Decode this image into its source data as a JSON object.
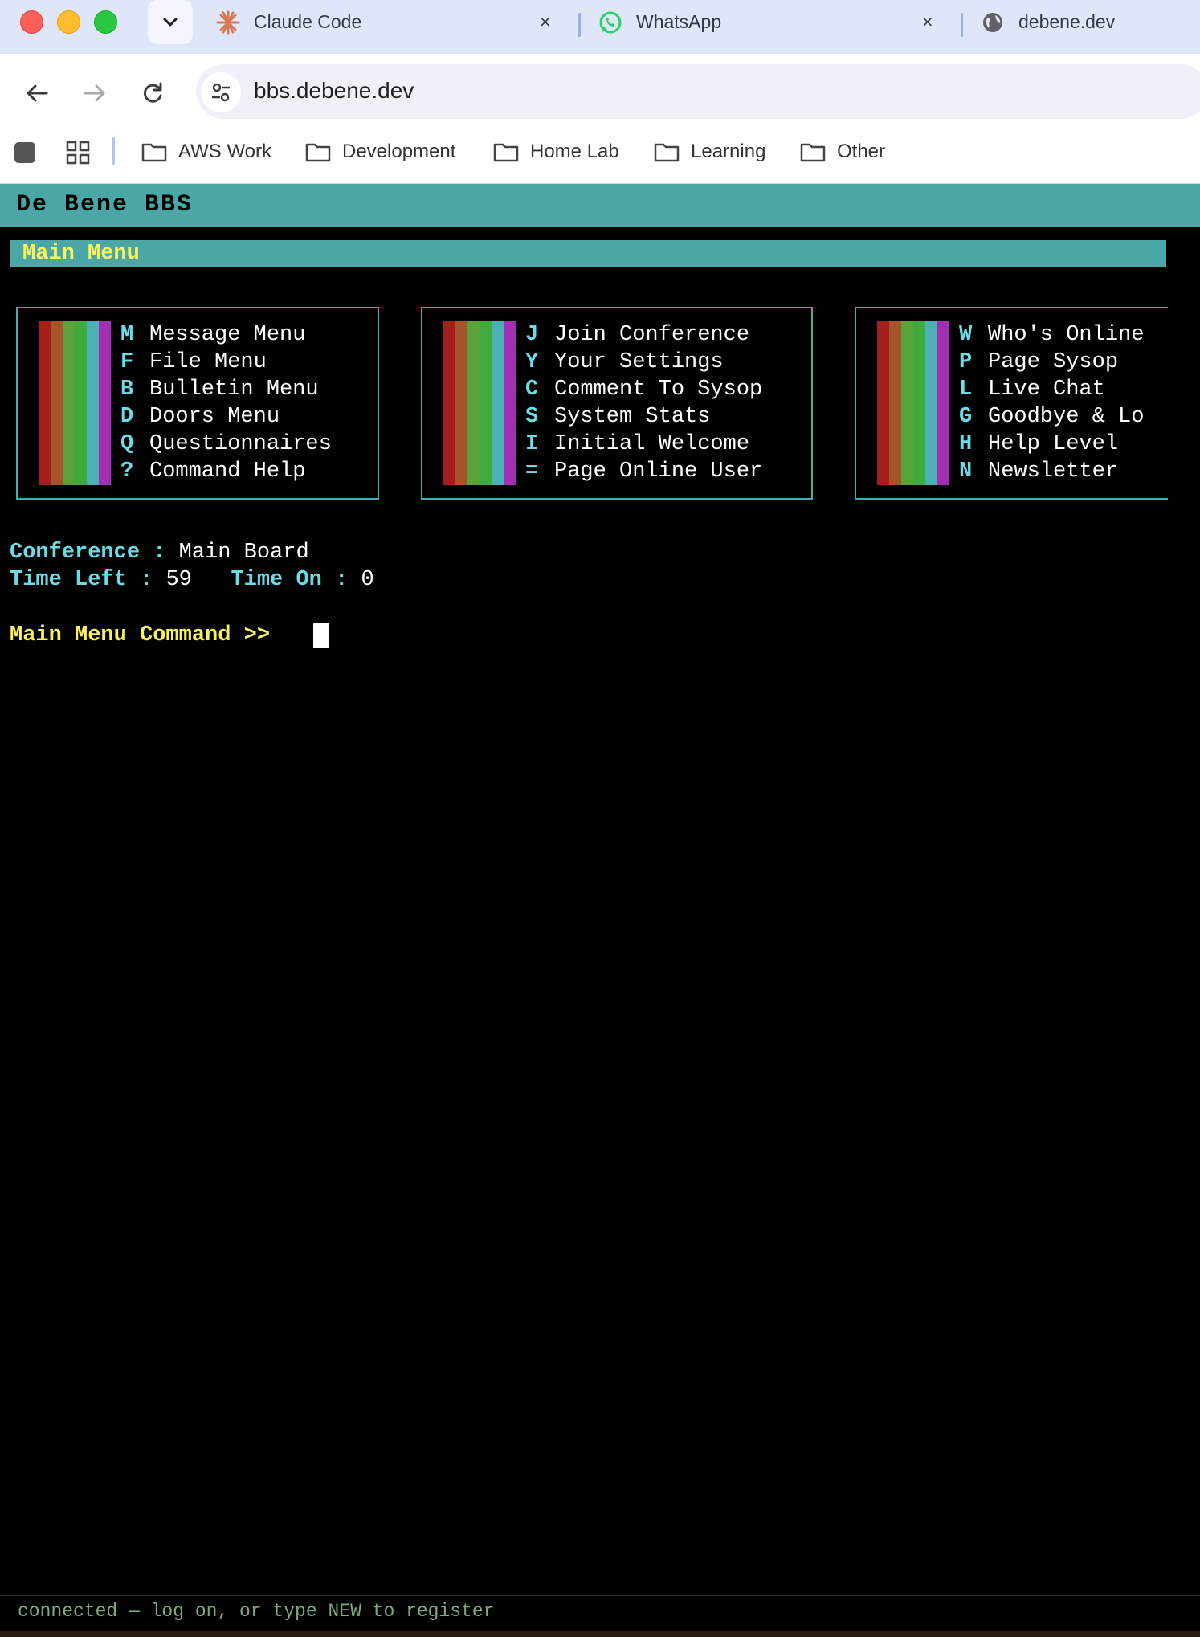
{
  "browser": {
    "tabs": [
      {
        "title": "Claude Code",
        "icon": "claude-icon"
      },
      {
        "title": "WhatsApp",
        "icon": "whatsapp-icon"
      },
      {
        "title": "debene.dev",
        "icon": "globe-icon"
      }
    ],
    "close_glyph": "×",
    "url": "bbs.debene.dev",
    "bookmarks": [
      "AWS Work",
      "Development",
      "Home Lab",
      "Learning",
      "Other"
    ]
  },
  "bbs": {
    "title": "De Bene BBS",
    "menu_header": "Main Menu",
    "columns": [
      [
        {
          "key": "M",
          "label": "Message Menu"
        },
        {
          "key": "F",
          "label": "File Menu"
        },
        {
          "key": "B",
          "label": "Bulletin Menu"
        },
        {
          "key": "D",
          "label": "Doors Menu"
        },
        {
          "key": "Q",
          "label": "Questionnaires"
        },
        {
          "key": "?",
          "label": "Command Help"
        }
      ],
      [
        {
          "key": "J",
          "label": "Join Conference"
        },
        {
          "key": "Y",
          "label": "Your Settings"
        },
        {
          "key": "C",
          "label": "Comment To Sysop"
        },
        {
          "key": "S",
          "label": "System Stats"
        },
        {
          "key": "I",
          "label": "Initial Welcome"
        },
        {
          "key": "=",
          "label": "Page Online User"
        }
      ],
      [
        {
          "key": "W",
          "label": "Who's Online"
        },
        {
          "key": "P",
          "label": "Page Sysop"
        },
        {
          "key": "L",
          "label": "Live Chat"
        },
        {
          "key": "G",
          "label": "Goodbye & Lo"
        },
        {
          "key": "H",
          "label": "Help Level"
        },
        {
          "key": "N",
          "label": "Newsletter"
        }
      ]
    ],
    "conference_label": "Conference :",
    "conference_value": "Main Board",
    "time_left_label": "Time Left :",
    "time_left_value": "59",
    "time_on_label": "Time On :",
    "time_on_value": "0",
    "prompt": "Main Menu Command >>",
    "status": "connected — log on, or type NEW to register",
    "colors": {
      "teal": "#4aa7a5",
      "yellow": "#fbf35d",
      "cyan": "#6bdbe6",
      "stripes": [
        "#a3201a",
        "#a5552a",
        "#5aa33a",
        "#3faa3d",
        "#4cb0b6",
        "#a12fb2"
      ]
    }
  }
}
